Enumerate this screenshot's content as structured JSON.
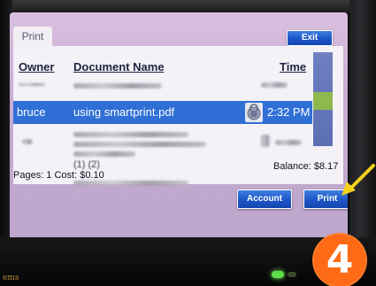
{
  "window": {
    "tab_label": "Print"
  },
  "buttons": {
    "exit_label": "Exit",
    "account_label": "Account",
    "print_label": "Print"
  },
  "table": {
    "columns": {
      "owner": "Owner",
      "document": "Document Name",
      "time": "Time"
    },
    "selected_row": {
      "owner": "bruce",
      "document": "using smartprint.pdf",
      "time": "2:32 PM",
      "status_icon": "lock-icon"
    },
    "partial_row_text": "(1) (2)"
  },
  "footer": {
    "pages_cost": "Pages: 1 Cost: $0.10",
    "balance": "Balance: $8.17"
  },
  "overlay": {
    "step_badge": "4",
    "arrow_color": "#f5d21a",
    "badge_color": "#ff6a16"
  },
  "colors": {
    "selection": "#2f6fd6",
    "button": "#1c55c6",
    "scroll_thumb": "#8fb84f"
  }
}
